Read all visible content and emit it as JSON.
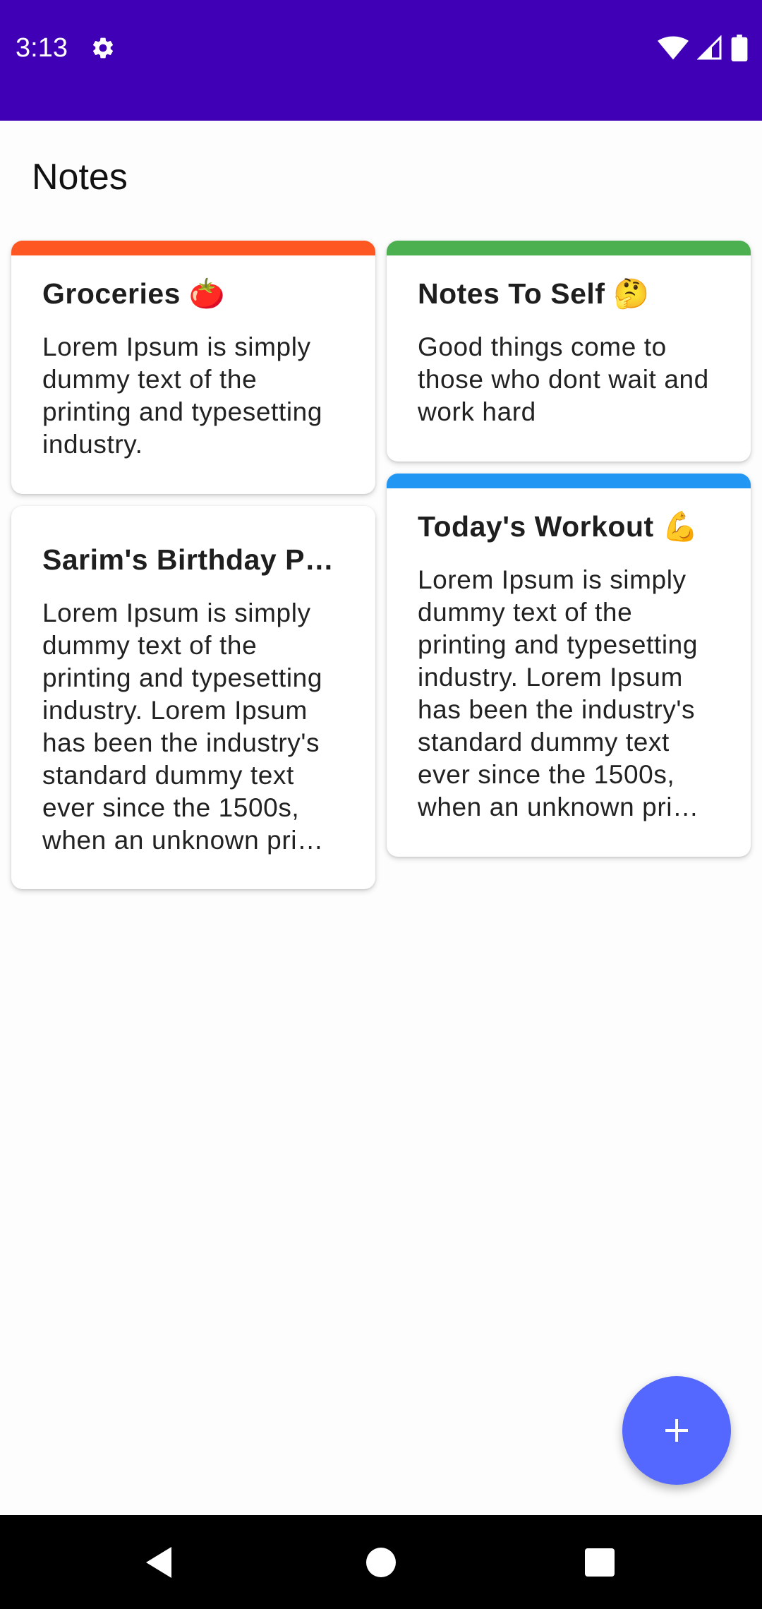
{
  "status_bar": {
    "time": "3:13",
    "background": "#4000B6",
    "icons": [
      "gear-icon",
      "wifi-icon",
      "cellular-signal-icon",
      "battery-icon"
    ]
  },
  "header": {
    "title": "Notes"
  },
  "notes": [
    {
      "title": "Groceries 🍅",
      "body": "Lorem Ipsum is simply dummy text of the printing and typesetting industry.",
      "accent": "#FF5722"
    },
    {
      "title": "Notes To Self 🤔",
      "body": "Good things come to those who dont wait and work hard",
      "accent": "#4CAF50"
    },
    {
      "title": "Sarim's Birthday P…",
      "body": "Lorem Ipsum is simply dummy text of the printing and typesetting industry. Lorem Ipsum has been the industry's standard dummy text ever since the 1500s, when an unknown pri…",
      "accent": "#FFFFFF"
    },
    {
      "title": "Today's Workout 💪",
      "body": "Lorem Ipsum is simply dummy text of the printing and typesetting industry. Lorem Ipsum has been the industry's standard dummy text ever since the 1500s, when an unknown pri…",
      "accent": "#2196F3"
    }
  ],
  "fab": {
    "icon": "plus-icon",
    "color": "#5468FF"
  },
  "nav_bar": {
    "icons": [
      "back-icon",
      "home-icon",
      "recents-icon"
    ]
  }
}
